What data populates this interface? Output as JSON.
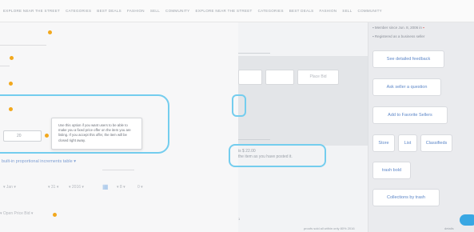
{
  "nav": {
    "items": [
      "EXPLORE NEAR THE STREET",
      "CATEGORIES",
      "BEST DEALS",
      "FASHION",
      "SELL",
      "COMMUNITY",
      "EXPLORE NEAR THE STREET",
      "CATEGORIES",
      "BEST DEALS",
      "FASHION",
      "SELL",
      "COMMUNITY"
    ]
  },
  "form": {
    "quantity_value": "20",
    "tooltip_text": "Use this option if you want users to be able to make you a fixed price offer on the item you are listing. If you accept this offer, the item will be closed right away.",
    "increments_link": "built-in proportional increments table",
    "date_month": "Jan",
    "date_day": "31",
    "date_year": "2016",
    "hour": "8",
    "minute": "0",
    "open_price_label": "Open Price Bid"
  },
  "middle": {
    "place_bid_label": "Place Bid",
    "info_line_1": "is $ 22.00",
    "info_line_2": "the item as you have posted it."
  },
  "sidebar": {
    "member_since": "Member since Jun. 8, 2006 in",
    "registered": "Registered as a business seller",
    "buttons": {
      "feedback": "See detailed feedback",
      "ask": "Ask seller a question",
      "favorite": "Add to Favorite Sellers",
      "store": "Store",
      "list": "List",
      "classifieds": "Classifieds",
      "trash": "trash bold",
      "collections": "Collections by trash"
    }
  },
  "footer": {
    "status_text": "proofs sold all within only 80% 2016",
    "right_text": "details"
  },
  "colors": {
    "highlight": "#74cdee",
    "required_dot": "#f2a81d",
    "link": "#5d87c8",
    "chat": "#39a7e3"
  }
}
